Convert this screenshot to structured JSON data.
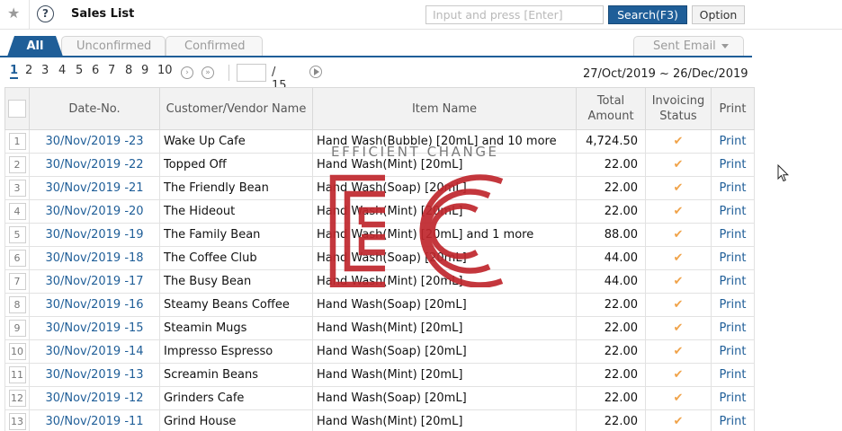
{
  "header": {
    "title": "Sales List",
    "search_placeholder": "Input and press [Enter]",
    "search_label": "Search(F3)",
    "option_label": "Option"
  },
  "tabs": [
    {
      "label": "All",
      "active": true
    },
    {
      "label": "Unconfirmed",
      "active": false
    },
    {
      "label": "Confirmed",
      "active": false
    }
  ],
  "sent_email_label": "Sent Email",
  "pagination": {
    "pages": [
      "1",
      "2",
      "3",
      "4",
      "5",
      "6",
      "7",
      "8",
      "9",
      "10"
    ],
    "current": "1",
    "total_label": "/ 15"
  },
  "date_range": "27/Oct/2019 ~ 26/Dec/2019",
  "table": {
    "headers": {
      "date_no": "Date-No.",
      "customer": "Customer/Vendor Name",
      "item": "Item Name",
      "total_line1": "Total",
      "total_line2": "Amount",
      "status_line1": "Invoicing",
      "status_line2": "Status",
      "print": "Print"
    },
    "rows": [
      {
        "num": "1",
        "date_no": "30/Nov/2019 -23",
        "customer": "Wake Up Cafe",
        "item": "Hand Wash(Bubble) [20mL] and 10 more",
        "total": "4,724.50",
        "status": "✔",
        "print": "Print"
      },
      {
        "num": "2",
        "date_no": "30/Nov/2019 -22",
        "customer": "Topped Off",
        "item": "Hand Wash(Mint) [20mL]",
        "total": "22.00",
        "status": "✔",
        "print": "Print"
      },
      {
        "num": "3",
        "date_no": "30/Nov/2019 -21",
        "customer": "The Friendly Bean",
        "item": "Hand Wash(Soap) [20mL]",
        "total": "22.00",
        "status": "✔",
        "print": "Print"
      },
      {
        "num": "4",
        "date_no": "30/Nov/2019 -20",
        "customer": "The Hideout",
        "item": "Hand Wash(Mint) [20mL]",
        "total": "22.00",
        "status": "✔",
        "print": "Print"
      },
      {
        "num": "5",
        "date_no": "30/Nov/2019 -19",
        "customer": "The Family Bean",
        "item": "Hand Wash(Mint) [20mL] and 1 more",
        "total": "88.00",
        "status": "✔",
        "print": "Print"
      },
      {
        "num": "6",
        "date_no": "30/Nov/2019 -18",
        "customer": "The Coffee Club",
        "item": "Hand Wash(Soap) [20mL]",
        "total": "44.00",
        "status": "✔",
        "print": "Print"
      },
      {
        "num": "7",
        "date_no": "30/Nov/2019 -17",
        "customer": "The Busy Bean",
        "item": "Hand Wash(Mint) [20mL]",
        "total": "44.00",
        "status": "✔",
        "print": "Print"
      },
      {
        "num": "8",
        "date_no": "30/Nov/2019 -16",
        "customer": "Steamy Beans Coffee",
        "item": "Hand Wash(Soap) [20mL]",
        "total": "22.00",
        "status": "✔",
        "print": "Print"
      },
      {
        "num": "9",
        "date_no": "30/Nov/2019 -15",
        "customer": "Steamin Mugs",
        "item": "Hand Wash(Mint) [20mL]",
        "total": "22.00",
        "status": "✔",
        "print": "Print"
      },
      {
        "num": "10",
        "date_no": "30/Nov/2019 -14",
        "customer": "Impresso Espresso",
        "item": "Hand Wash(Soap) [20mL]",
        "total": "22.00",
        "status": "✔",
        "print": "Print"
      },
      {
        "num": "11",
        "date_no": "30/Nov/2019 -13",
        "customer": "Screamin Beans",
        "item": "Hand Wash(Mint) [20mL]",
        "total": "22.00",
        "status": "✔",
        "print": "Print"
      },
      {
        "num": "12",
        "date_no": "30/Nov/2019 -12",
        "customer": "Grinders Cafe",
        "item": "Hand Wash(Soap) [20mL]",
        "total": "22.00",
        "status": "✔",
        "print": "Print"
      },
      {
        "num": "13",
        "date_no": "30/Nov/2019 -11",
        "customer": "Grind House",
        "item": "Hand Wash(Mint) [20mL]",
        "total": "22.00",
        "status": "✔",
        "print": "Print"
      }
    ]
  },
  "watermark": {
    "text": "EFFICIENT CHANGE",
    "color": "#c0272d"
  },
  "colors": {
    "accent": "#1f5e98",
    "check": "#f0a34a"
  },
  "icons": {
    "favorite": "star-icon",
    "help": "help-icon",
    "next": "chevron-right-icon",
    "last": "double-chevron-right-icon",
    "go": "play-icon",
    "dropdown": "caret-down-icon"
  }
}
